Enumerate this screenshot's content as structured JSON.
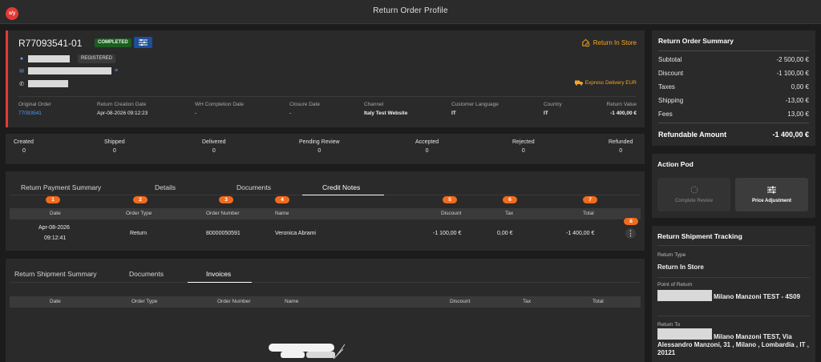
{
  "app": {
    "logo_text": "x/y",
    "title": "Return Order Profile"
  },
  "order": {
    "id": "R77093541-01",
    "status": "COMPLETED",
    "customer_status": "REGISTERED",
    "return_type": "Return In Store",
    "delivery": "Express Delivery EUR",
    "meta": [
      {
        "label": "Original Order",
        "value": "77093541"
      },
      {
        "label": "Return Creation Date",
        "value": "Apr-08-2026 09:12:23"
      },
      {
        "label": "WH Completion Date",
        "value": "-"
      },
      {
        "label": "Closure Date",
        "value": "-"
      },
      {
        "label": "Channel",
        "value": "Italy Test Website"
      },
      {
        "label": "Customer Language",
        "value": "IT"
      },
      {
        "label": "Country",
        "value": "IT"
      },
      {
        "label": "Return Value",
        "value": "-1 400,00 €"
      }
    ]
  },
  "statuses": [
    {
      "label": "Created",
      "value": "0"
    },
    {
      "label": "Shipped",
      "value": "0"
    },
    {
      "label": "Delivered",
      "value": "0"
    },
    {
      "label": "Pending Review",
      "value": "0"
    },
    {
      "label": "Accepted",
      "value": "0"
    },
    {
      "label": "Rejected",
      "value": "0"
    },
    {
      "label": "Refunded",
      "value": "0"
    }
  ],
  "payment_panel": {
    "tabs": [
      "Return Payment Summary",
      "Details",
      "Documents",
      "Credit Notes"
    ],
    "active_tab": "Credit Notes",
    "markers": [
      "1",
      "2",
      "3",
      "4",
      "5",
      "6",
      "7",
      "8"
    ],
    "columns": [
      "Date",
      "Order Type",
      "Order Number",
      "Name",
      "Discount",
      "Tax",
      "Total"
    ],
    "row": {
      "date": "Apr-08-2026",
      "time": "09:12:41",
      "order_type": "Return",
      "order_number": "80000050591",
      "name": "Veronica Abrami",
      "discount": "-1 100,00 €",
      "tax": "0,00 €",
      "total": "-1 400,00 €"
    }
  },
  "shipment_panel": {
    "tabs": [
      "Return Shipment Summary",
      "Documents",
      "Invoices"
    ],
    "active_tab": "Invoices",
    "columns": [
      "Date",
      "Order Type",
      "Order Number",
      "Name",
      "Discount",
      "Tax",
      "Total"
    ]
  },
  "summary": {
    "title": "Return Order Summary",
    "rows": [
      {
        "label": "Subtotal",
        "value": "-2 500,00 €"
      },
      {
        "label": "Discount",
        "value": "-1 100,00 €"
      },
      {
        "label": "Taxes",
        "value": "0,00 €"
      },
      {
        "label": "Shipping",
        "value": "-13,00 €"
      },
      {
        "label": "Fees",
        "value": "13,00 €"
      }
    ],
    "refundable_label": "Refundable Amount",
    "refundable_value": "-1 400,00 €"
  },
  "action_pod": {
    "title": "Action Pod",
    "complete_review": "Complete Review",
    "price_adjustment": "Price Adjustment"
  },
  "tracking": {
    "title": "Return Shipment Tracking",
    "return_type_label": "Return Type",
    "return_type_value": "Return In Store",
    "point_label": "Point of Return",
    "point_value": "Milano Manzoni TEST - 4S09",
    "return_to_label": "Return To",
    "return_to_value": "Milano Manzoni TEST, Via Alessandro Manzoni, 31 , Milano , Lombardia , IT , 20121"
  },
  "colors": {
    "accent_red": "#e53935",
    "orange": "#f5a623",
    "marker": "#f26b1d",
    "link": "#4a9cff",
    "badge_green": "#1b5e20"
  }
}
